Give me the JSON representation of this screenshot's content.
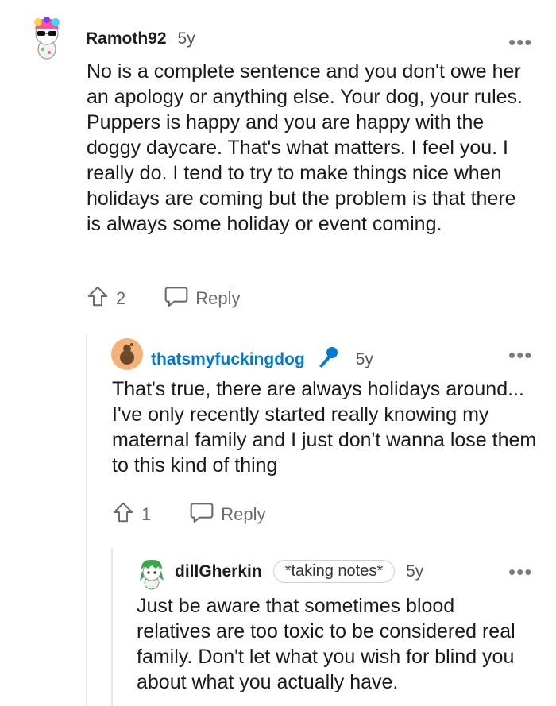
{
  "comments": [
    {
      "username": "Ramoth92",
      "time": "5y",
      "text": "No is a complete sentence and you don't owe her an apology or anything else. Your dog, your rules. Puppers is happy and you are happy with the doggy daycare. That's what matters. I feel you. I really do. I tend to try to make things nice when holidays are coming but the problem is that there is always some holiday or event coming.",
      "upvotes": "2",
      "reply_label": "Reply",
      "more": "•••"
    },
    {
      "username": "thatsmyfuckingdog",
      "time": "5y",
      "text": "That's true, there are always holidays around... I've only recently started really knowing my maternal family and I just don't wanna lose them to this kind of thing",
      "upvotes": "1",
      "reply_label": "Reply",
      "more": "•••"
    },
    {
      "username": "dillGherkin",
      "flair": "*taking notes*",
      "time": "5y",
      "text": "Just be aware that sometimes blood relatives are too toxic to be considered real family. Don't let what you wish for blind you about what you actually have.",
      "more": "•••"
    }
  ],
  "colors": {
    "op_badge": "#0079d3",
    "link_username": "#0079d3",
    "thread_line": "#e6e6e6"
  }
}
